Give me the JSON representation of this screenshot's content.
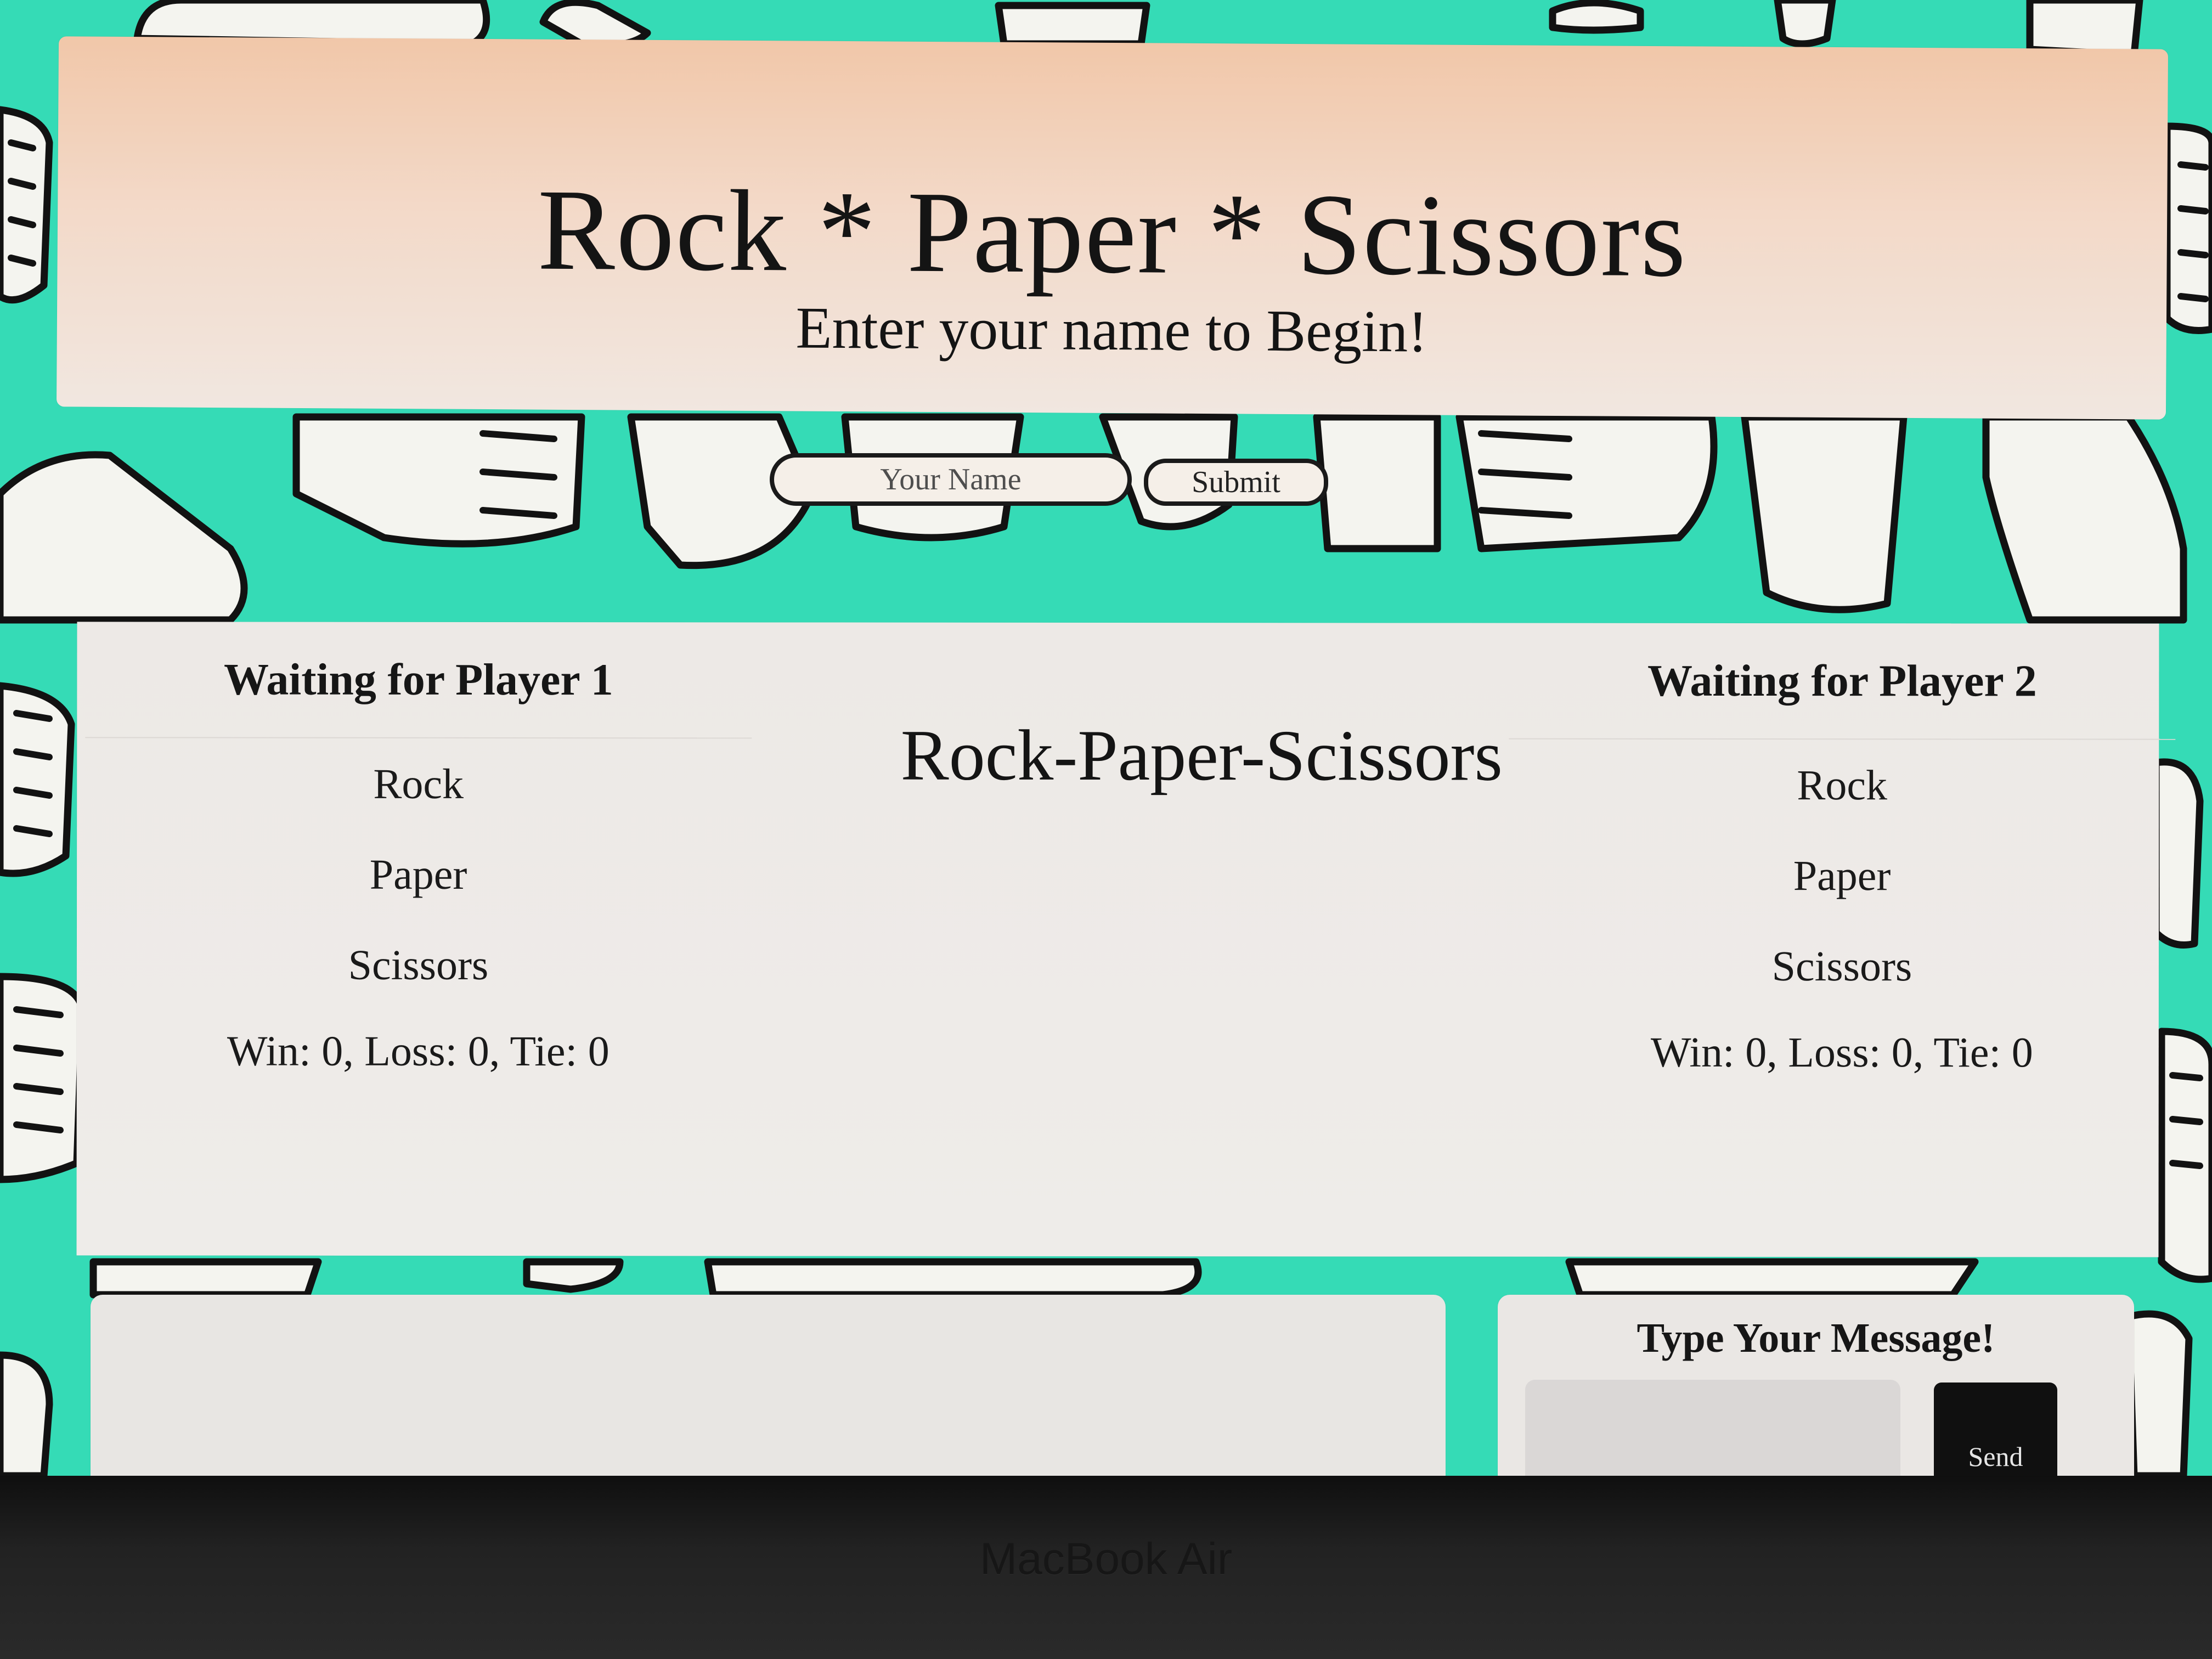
{
  "header": {
    "title": "Rock * Paper * Scissors",
    "subtitle": "Enter your name to Begin!"
  },
  "name_form": {
    "placeholder": "Your Name",
    "submit_label": "Submit"
  },
  "game": {
    "title": "Rock-Paper-Scissors",
    "players": [
      {
        "status": "Waiting for Player 1",
        "choices": [
          "Rock",
          "Paper",
          "Scissors"
        ],
        "score": "Win: 0, Loss: 0, Tie: 0"
      },
      {
        "status": "Waiting for Player 2",
        "choices": [
          "Rock",
          "Paper",
          "Scissors"
        ],
        "score": "Win: 0, Loss: 0, Tie: 0"
      }
    ]
  },
  "chat": {
    "title": "Type Your Message!",
    "send_label": "Send"
  },
  "device": {
    "label": "MacBook Air"
  },
  "colors": {
    "background": "#35dbb6",
    "panel": "#ece9e6",
    "header_top": "#f1c7a9",
    "send_button": "#101010"
  }
}
